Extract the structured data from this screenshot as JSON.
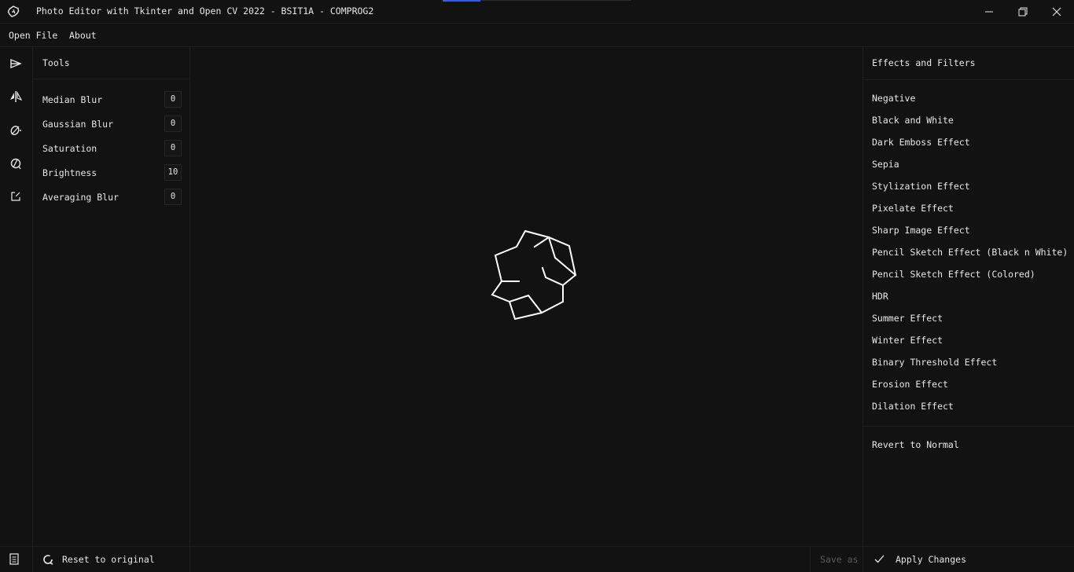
{
  "window": {
    "title": "Photo Editor with Tkinter and Open CV 2022 - BSIT1A - COMPROG2",
    "accent_color": "#3b5bdb",
    "controls": [
      "minimize-icon",
      "restore-icon",
      "close-icon"
    ]
  },
  "menu": {
    "items": [
      {
        "label": "Open File"
      },
      {
        "label": "About"
      }
    ]
  },
  "rail": {
    "icons": [
      "effects-icon",
      "mirror-icon",
      "eraser-icon",
      "filter-icon",
      "edit-icon"
    ],
    "bottom_icon": "document-icon"
  },
  "tools": {
    "title": "Tools",
    "items": [
      {
        "label": "Median Blur",
        "value": "0"
      },
      {
        "label": "Gaussian Blur",
        "value": "0"
      },
      {
        "label": "Saturation",
        "value": "0"
      },
      {
        "label": "Brightness",
        "value": "10"
      },
      {
        "label": "Averaging Blur",
        "value": "0"
      }
    ],
    "reset_label": "Reset to original"
  },
  "canvas": {
    "placeholder_icon": "app-logo-icon"
  },
  "effects": {
    "title": "Effects and Filters",
    "items": [
      "Negative",
      "Black and White",
      "Dark Emboss Effect",
      "Sepia",
      "Stylization Effect",
      "Pixelate Effect",
      "Sharp Image Effect",
      "Pencil Sketch Effect (Black n White)",
      "Pencil Sketch Effect (Colored)",
      "HDR",
      "Summer Effect",
      "Winter Effect",
      "Binary Threshold Effect",
      "Erosion Effect",
      "Dilation Effect"
    ],
    "revert_label": "Revert to Normal"
  },
  "footer": {
    "save_label": "Save as",
    "apply_label": "Apply Changes"
  }
}
